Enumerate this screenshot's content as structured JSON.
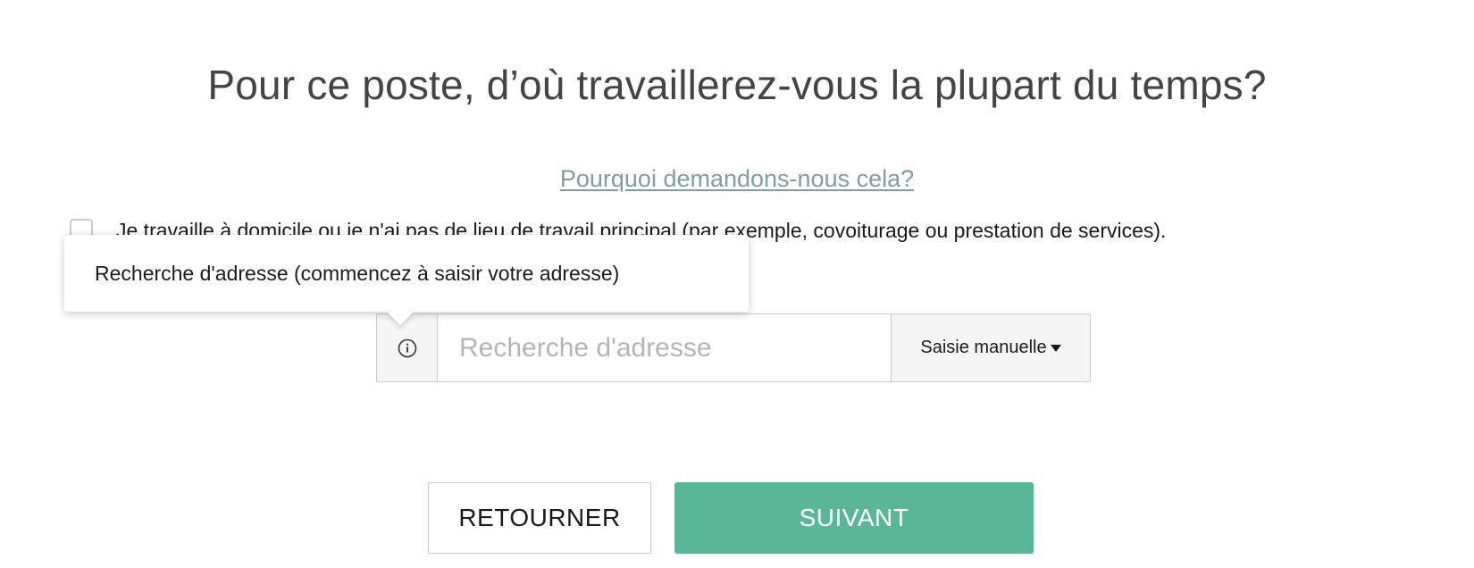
{
  "page": {
    "title": "Pour ce poste, d’où travaillerez-vous la plupart du temps?",
    "why_link": "Pourquoi demandons-nous cela?"
  },
  "remote_option": {
    "label": "Je travaille à domicile ou je n'ai pas de lieu de travail principal (par exemple, covoiturage ou prestation de services).",
    "checked": false
  },
  "tooltip": {
    "text": "Recherche d'adresse (commencez à saisir votre adresse)"
  },
  "address": {
    "info_icon": "info-circle-icon",
    "placeholder": "Recherche d'adresse",
    "value": "",
    "manual_button_label": "Saisie manuelle",
    "manual_button_icon": "caret-down-icon"
  },
  "actions": {
    "back_label": "RETOURNER",
    "next_label": "SUIVANT"
  },
  "colors": {
    "primary": "#59b697",
    "link": "#7f9e9c",
    "title_text": "#444444",
    "placeholder": "#b5b5b5",
    "border": "#cccccc"
  }
}
